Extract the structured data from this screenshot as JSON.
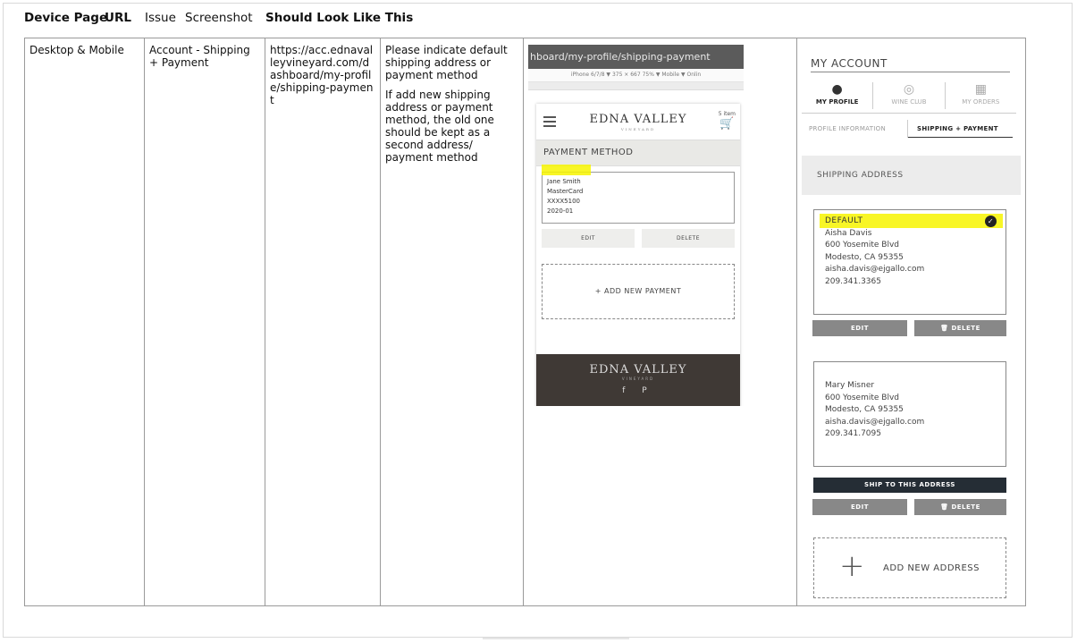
{
  "headers": [
    "Device Page",
    "URL",
    "Issue",
    "Screenshot",
    "Should Look Like This"
  ],
  "row": {
    "device": "Desktop & Mobile",
    "page": "Account - Shipping + Payment",
    "url": "https://acc.ednavalleyvineyard.com/dashboard/my-profile/shipping-payment",
    "issue_p1": "Please indicate default shipping address or payment method",
    "issue_p2": "If add new shipping address or payment method, the old one should be kept as a second address/ payment method"
  },
  "mobile": {
    "address_bar": "hboard/my-profile/shipping-payment",
    "device_toolbar": "iPhone 6/7/8 ▼   375  ×  667   75% ▼  Mobile ▼  Onlin",
    "brand": "EDNA VALLEY",
    "brand_sub": "VINEYARD",
    "cart_count": "5 item",
    "section_title": "PAYMENT METHOD",
    "card": {
      "name": "Jane Smith",
      "type": "MasterCard",
      "number": "XXXX5100",
      "expiry": "2020-01"
    },
    "edit_label": "EDIT",
    "delete_label": "DELETE",
    "add_payment_label": "+ ADD NEW PAYMENT",
    "footer_brand": "EDNA VALLEY",
    "footer_sub": "VINEYARD",
    "social": "f  P"
  },
  "desktop": {
    "title": "MY ACCOUNT",
    "tabs": [
      {
        "label": "MY PROFILE",
        "icon": "person-icon",
        "active": true
      },
      {
        "label": "WINE CLUB",
        "icon": "wine-club-icon",
        "active": false
      },
      {
        "label": "MY ORDERS",
        "icon": "orders-icon",
        "active": false
      }
    ],
    "subtabs": [
      "PROFILE INFORMATION",
      "SHIPPING + PAYMENT"
    ],
    "section_title": "SHIPPING ADDRESS",
    "default_label": "DEFAULT",
    "address1": {
      "name": "Aisha Davis",
      "street": "600 Yosemite Blvd",
      "city": "Modesto, CA 95355",
      "email": "aisha.davis@ejgallo.com",
      "phone": "209.341.3365"
    },
    "address2": {
      "name": "Mary Misner",
      "street": "600 Yosemite Blvd",
      "city": "Modesto, CA 95355",
      "email": "aisha.davis@ejgallo.com",
      "phone": "209.341.7095"
    },
    "edit_label": "EDIT",
    "delete_label": "DELETE",
    "ship_label": "SHIP TO THIS ADDRESS",
    "add_address_label": "ADD NEW ADDRESS",
    "accent_highlight": "#f7f500"
  }
}
